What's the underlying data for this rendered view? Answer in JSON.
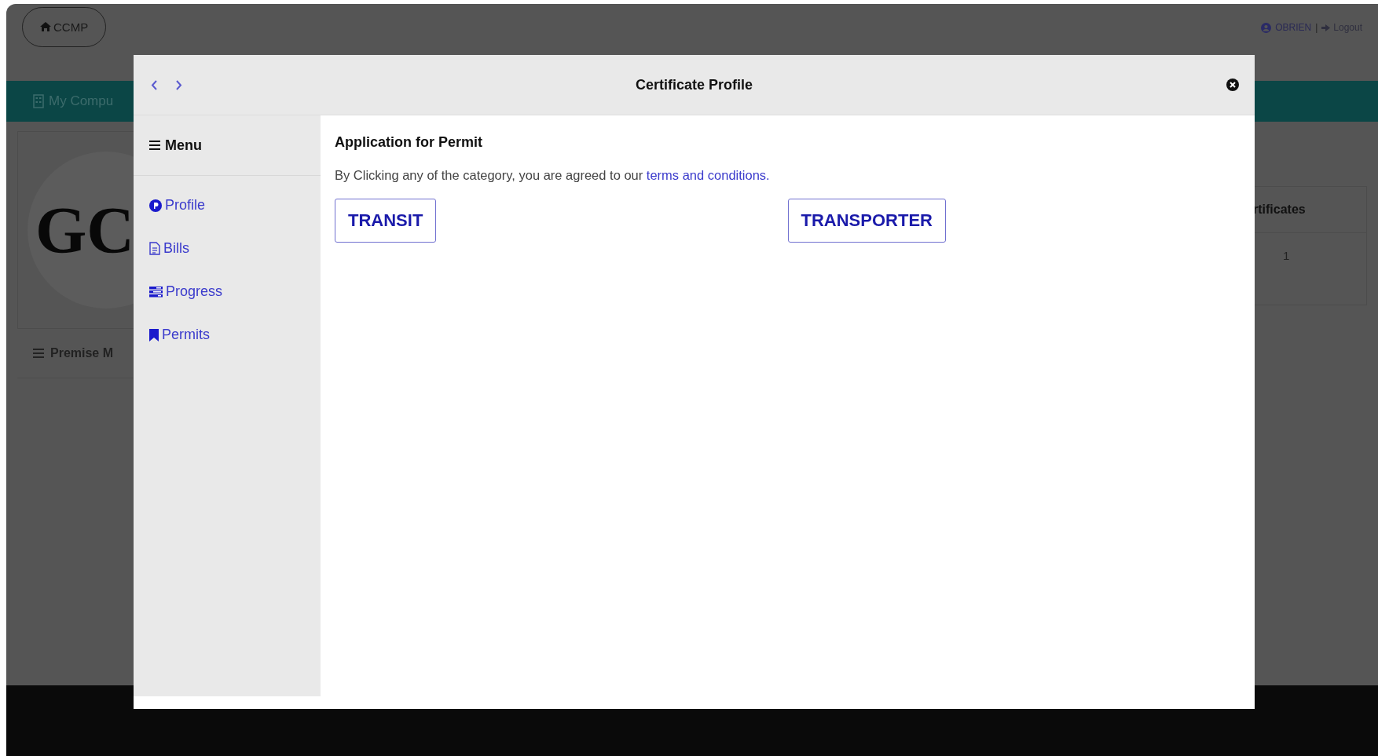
{
  "app": {
    "home_button": "CCMP",
    "user": "OBRIEN",
    "separator": "|",
    "logout": "Logout",
    "nav_title": "My Compu",
    "logo_text": "GC",
    "section_title": "Premise M",
    "stat_header": "rtificates",
    "stat_value": "1"
  },
  "modal": {
    "title": "Certificate Profile",
    "menu_title": "Menu",
    "menu_items": [
      {
        "kind": "profile",
        "label": "Profile"
      },
      {
        "kind": "bills",
        "label": "Bills"
      },
      {
        "kind": "progress",
        "label": "Progress"
      },
      {
        "kind": "permits",
        "label": "Permits"
      }
    ],
    "heading": "Application for Permit",
    "notice": "By Clicking any of the category, you are agreed to our ",
    "notice_link": "terms and conditions.",
    "categories": [
      "TRANSIT",
      "TRANSPORTER"
    ]
  }
}
